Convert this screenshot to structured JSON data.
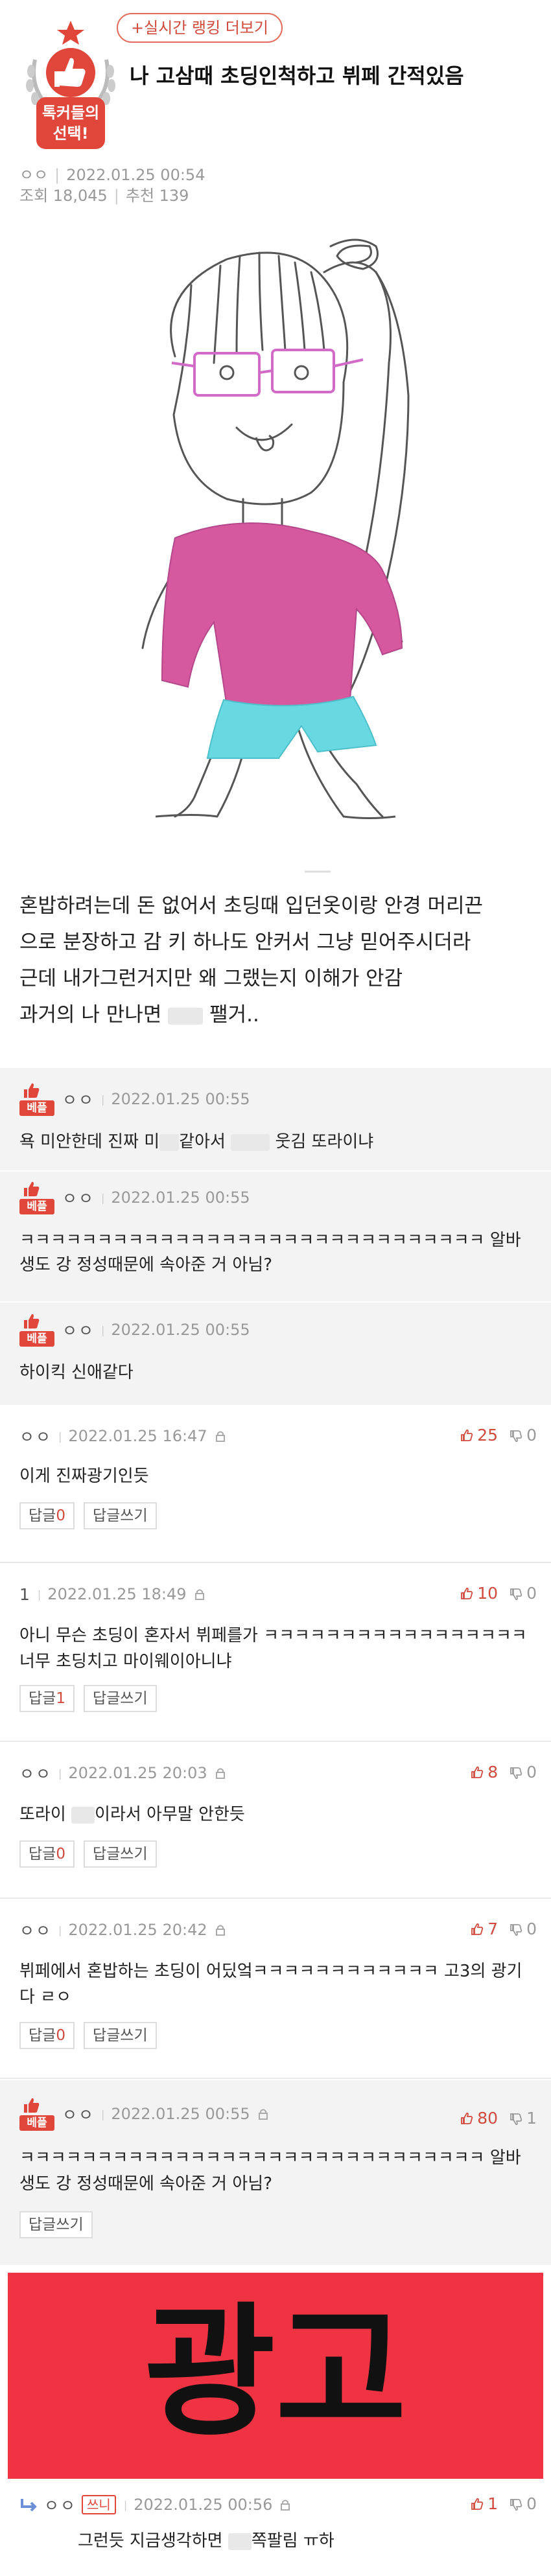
{
  "header": {
    "rank_link": "+실시간 랭킹 더보기",
    "badge_text_1": "톡커들의",
    "badge_text_2": "선택!",
    "title": "나 고삼때 초딩인척하고 뷔페 간적있음",
    "author": "ㅇㅇ",
    "date": "2022.01.25 00:54",
    "views": "조회 18,045",
    "recommends": "추천 139"
  },
  "post": {
    "lines": [
      "혼밥하려는데 돈 없어서 초딩때 입던옷이랑 안경 머리끈",
      "으로 분장하고 감 키 하나도 안커서 그냥 믿어주시더라",
      "근데 내가그런거지만 왜 그랬는지 이해가 안감"
    ],
    "last_line_a": "과거의 나 만나면",
    "last_line_b": "팰거.."
  },
  "best_comments": [
    {
      "tag": "베플",
      "nick": "ㅇㅇ",
      "date": "2022.01.25 00:55",
      "text_a": "욕 미안한데 진짜 미",
      "text_b": "같아서",
      "text_c": "웃김 또라이냐"
    },
    {
      "tag": "베플",
      "nick": "ㅇㅇ",
      "date": "2022.01.25 00:55",
      "line1": "ㅋㅋㅋㅋㅋㅋㅋㅋㅋㅋㅋㅋㅋㅋㅋㅋㅋㅋㅋㅋㅋㅋㅋㅋㅋㅋㅋㅋㅋㅋ 알바",
      "line2": "생도 강 정성때문에 속아준 거 아님?"
    },
    {
      "tag": "베플",
      "nick": "ㅇㅇ",
      "date": "2022.01.25 00:55",
      "line1": "하이킥 신애같다"
    }
  ],
  "comments": [
    {
      "nick": "ㅇㅇ",
      "date": "2022.01.25 16:47",
      "up": "25",
      "down": "0",
      "line1": "이게 진짜광기인듯",
      "reply_label": "답글",
      "reply_count": "0",
      "write_label": "답글쓰기"
    },
    {
      "nick": "1",
      "date": "2022.01.25 18:49",
      "up": "10",
      "down": "0",
      "line1": "아니 무슨 초딩이 혼자서 뷔페를가 ㅋㅋㅋㅋㅋㅋㅋㅋㅋㅋㅋㅋㅋㅋㅋㅋㅋ",
      "line2": "너무 초딩치고 마이웨이아니냐",
      "reply_label": "답글",
      "reply_count": "1",
      "write_label": "답글쓰기"
    },
    {
      "nick": "ㅇㅇ",
      "date": "2022.01.25 20:03",
      "up": "8",
      "down": "0",
      "line1a": "또라이",
      "line1b": "이라서 아무말 안한듯",
      "reply_label": "답글",
      "reply_count": "0",
      "write_label": "답글쓰기"
    },
    {
      "nick": "ㅇㅇ",
      "date": "2022.01.25 20:42",
      "up": "7",
      "down": "0",
      "line1": "뷔페에서 혼밥하는 초딩이 어딨엌ㅋㅋㅋㅋㅋㅋㅋㅋㅋㅋㅋㅋ 고3의 광기",
      "line2": "다 ㄹㅇ",
      "reply_label": "답글",
      "reply_count": "0",
      "write_label": "답글쓰기"
    }
  ],
  "best_comment_repeat": {
    "tag": "베플",
    "nick": "ㅇㅇ",
    "date": "2022.01.25 00:55",
    "up": "80",
    "down": "1",
    "line1": "ㅋㅋㅋㅋㅋㅋㅋㅋㅋㅋㅋㅋㅋㅋㅋㅋㅋㅋㅋㅋㅋㅋㅋㅋㅋㅋㅋㅋㅋㅋ 알바",
    "line2": "생도 강 정성때문에 속아준 거 아님?",
    "write_label": "답글쓰기"
  },
  "ad": {
    "text": "광고"
  },
  "reply": {
    "nick": "ㅇㅇ",
    "author_tag": "쓰니",
    "date": "2022.01.25 00:56",
    "up": "1",
    "down": "0",
    "text_a": "그런듯 지금생각하면",
    "text_b": "쪽팔림 ㅠ하"
  },
  "colors": {
    "accent": "#e0463a",
    "ad_bg": "#f03342",
    "shirt": "#d6589f",
    "shorts": "#68d8e2"
  }
}
